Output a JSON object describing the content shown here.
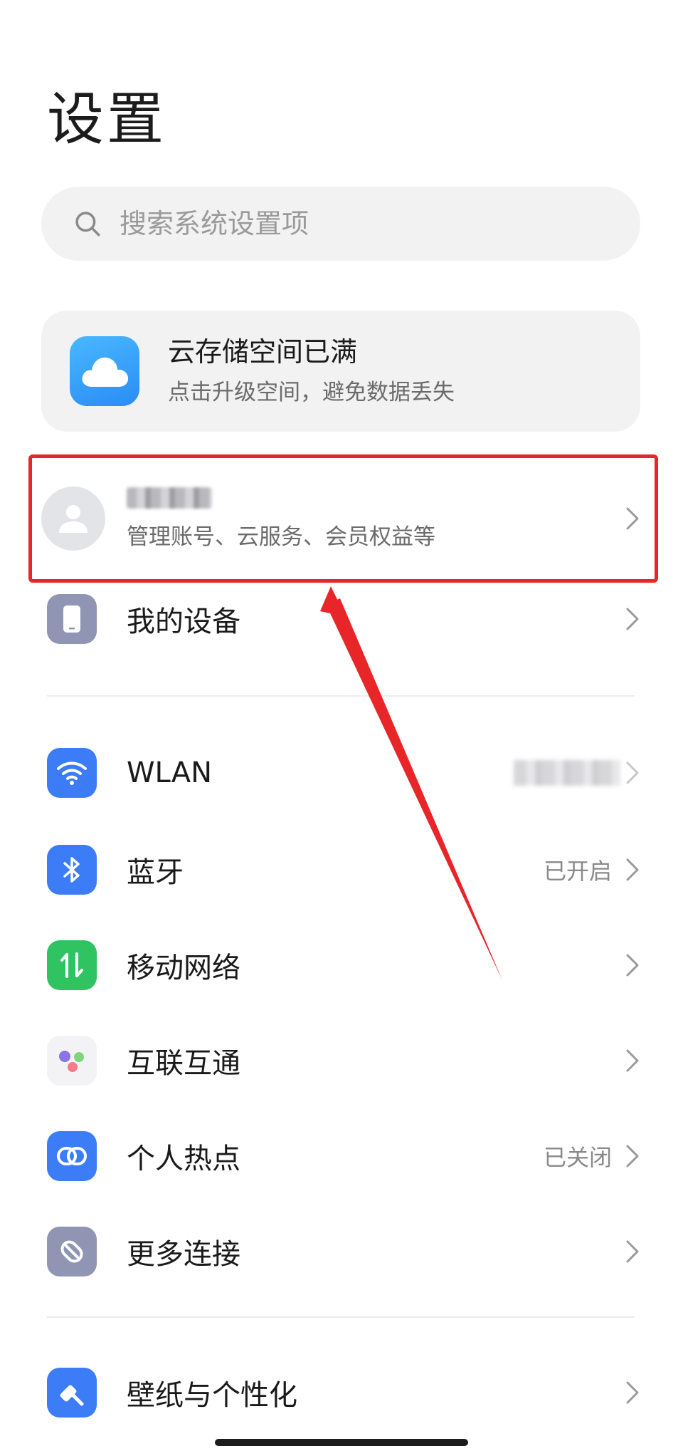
{
  "header": {
    "title": "设置"
  },
  "search": {
    "placeholder": "搜索系统设置项"
  },
  "cloud_card": {
    "title": "云存储空间已满",
    "subtitle": "点击升级空间，避免数据丢失"
  },
  "account": {
    "subtitle": "管理账号、云服务、会员权益等"
  },
  "my_devices": {
    "label": "我的设备"
  },
  "connectivity": [
    {
      "label": "WLAN",
      "value": "",
      "icon": "wifi-icon",
      "color": "#3d7cf7"
    },
    {
      "label": "蓝牙",
      "value": "已开启",
      "icon": "bluetooth-icon",
      "color": "#3d7cf7"
    },
    {
      "label": "移动网络",
      "value": "",
      "icon": "mobile-data-icon",
      "color": "#2fc461"
    },
    {
      "label": "互联互通",
      "value": "",
      "icon": "interconnect-icon",
      "color": "#f3f3f5"
    },
    {
      "label": "个人热点",
      "value": "已关闭",
      "icon": "hotspot-icon",
      "color": "#3d7cf7"
    },
    {
      "label": "更多连接",
      "value": "",
      "icon": "more-connections-icon",
      "color": "#8f95b2"
    }
  ],
  "personalization": {
    "label": "壁纸与个性化"
  },
  "colors": {
    "accent": "#3d7cf7",
    "highlight": "#e8262a"
  }
}
